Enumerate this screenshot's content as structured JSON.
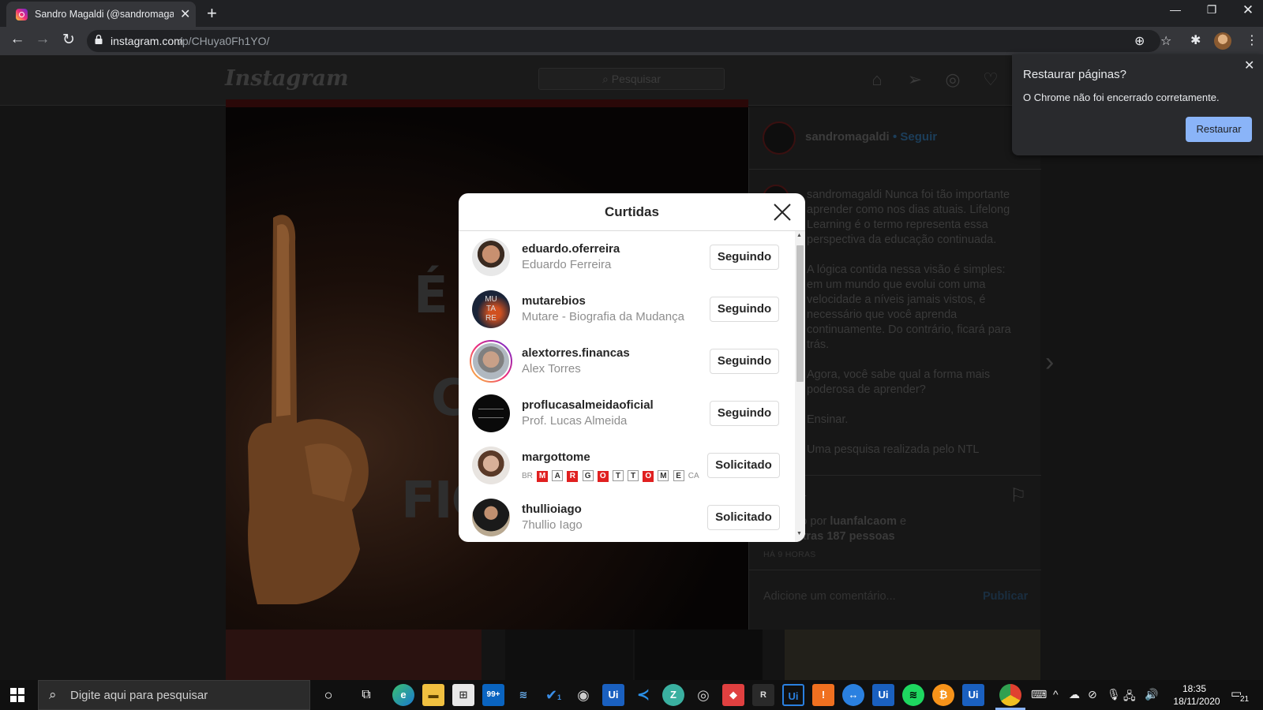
{
  "browser": {
    "tab_title": "Sandro Magaldi (@sandromagaldi)",
    "url_domain": "instagram.com",
    "url_path": "/p/CHuya0Fh1YO/"
  },
  "instagram": {
    "logo": "Instagram",
    "search_placeholder": "Pesquisar",
    "post_text_lines": [
      "É N",
      "C",
      "FIC"
    ],
    "owner_username": "sandromagaldi",
    "follow_label": "• Seguir",
    "caption": "sandromagaldi Nunca foi tão importante aprender como nos dias atuais. Lifelong Learning é o termo representa essa perspectiva da educação continuada.\n\nA lógica contida nessa visão é simples: em um mundo que evolui com uma velocidade a níveis jamais vistos, é necessário que você aprenda continuamente. Do contrário, ficará para trás.\n\nAgora, você sabe qual a forma mais poderosa de aprender?\n\nEnsinar.\n\nUma pesquisa realizada pelo NTL",
    "likes_prefix": "tido por",
    "likes_user": "luanfalcaom",
    "likes_and": "e",
    "likes_others": "outras 187 pessoas",
    "time_ago": "HÁ 9 HORAS",
    "comment_placeholder": "Adicione um comentário...",
    "publish_label": "Publicar"
  },
  "likes_modal": {
    "title": "Curtidas",
    "users": [
      {
        "username": "eduardo.oferreira",
        "full_name": "Eduardo Ferreira",
        "button": "Seguindo"
      },
      {
        "username": "mutarebios",
        "full_name": "Mutare - Biografia da Mudança",
        "button": "Seguindo"
      },
      {
        "username": "alextorres.financas",
        "full_name": "Alex Torres",
        "button": "Seguindo"
      },
      {
        "username": "proflucasalmeidaoficial",
        "full_name": "Prof. Lucas Almeida",
        "button": "Seguindo"
      },
      {
        "username": "margottome",
        "full_name": "BR MARGOTTOME CA",
        "button": "Solicitado"
      },
      {
        "username": "thullioiago",
        "full_name": "7hullio Iago",
        "button": "Solicitado"
      }
    ],
    "mutare_avatar_text": [
      "MU",
      "TA",
      "RE"
    ],
    "margo_prefix": "BR",
    "margo_letters": [
      "M",
      "A",
      "R",
      "G",
      "O",
      "T",
      "T",
      "O",
      "M",
      "E"
    ],
    "margo_suffix": "CA"
  },
  "restore_popup": {
    "title": "Restaurar páginas?",
    "message": "O Chrome não foi encerrado corretamente.",
    "button": "Restaurar"
  },
  "taskbar": {
    "search_placeholder": "Digite aqui para pesquisar",
    "mail_badge": "99+",
    "todo_badge": "1",
    "time": "18:35",
    "date": "18/11/2020",
    "notification_count": "21"
  }
}
